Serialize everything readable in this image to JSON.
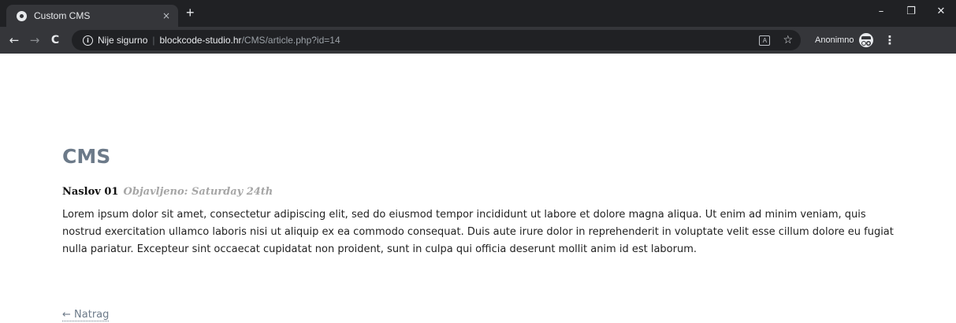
{
  "browser": {
    "tab": {
      "title": "Custom CMS",
      "close": "×"
    },
    "new_tab": "+",
    "window_controls": {
      "minimize": "–",
      "restore": "❐",
      "close": "✕"
    },
    "nav": {
      "back": "←",
      "forward": "→",
      "reload": "C"
    },
    "omnibox": {
      "security_label": "Nije sigurno",
      "separator": "|",
      "host": "blockcode-studio.hr",
      "path": "/CMS/article.php?id=14"
    },
    "profile": {
      "label": "Anonimno"
    }
  },
  "page": {
    "site_title": "CMS",
    "article": {
      "title": "Naslov 01",
      "published": "Objavljeno: Saturday 24th",
      "body": "Lorem ipsum dolor sit amet, consectetur adipiscing elit, sed do eiusmod tempor incididunt ut labore et dolore magna aliqua. Ut enim ad minim veniam, quis nostrud exercitation ullamco laboris nisi ut aliquip ex ea commodo consequat. Duis aute irure dolor in reprehenderit in voluptate velit esse cillum dolore eu fugiat nulla pariatur. Excepteur sint occaecat cupidatat non proident, sunt in culpa qui officia deserunt mollit anim id est laborum."
    },
    "back_link": "← Natrag"
  },
  "colors": {
    "chrome_dark": "#202124",
    "chrome_toolbar": "#35363a",
    "site_title": "#6c7a89",
    "date_gray": "#a6a6a6"
  }
}
